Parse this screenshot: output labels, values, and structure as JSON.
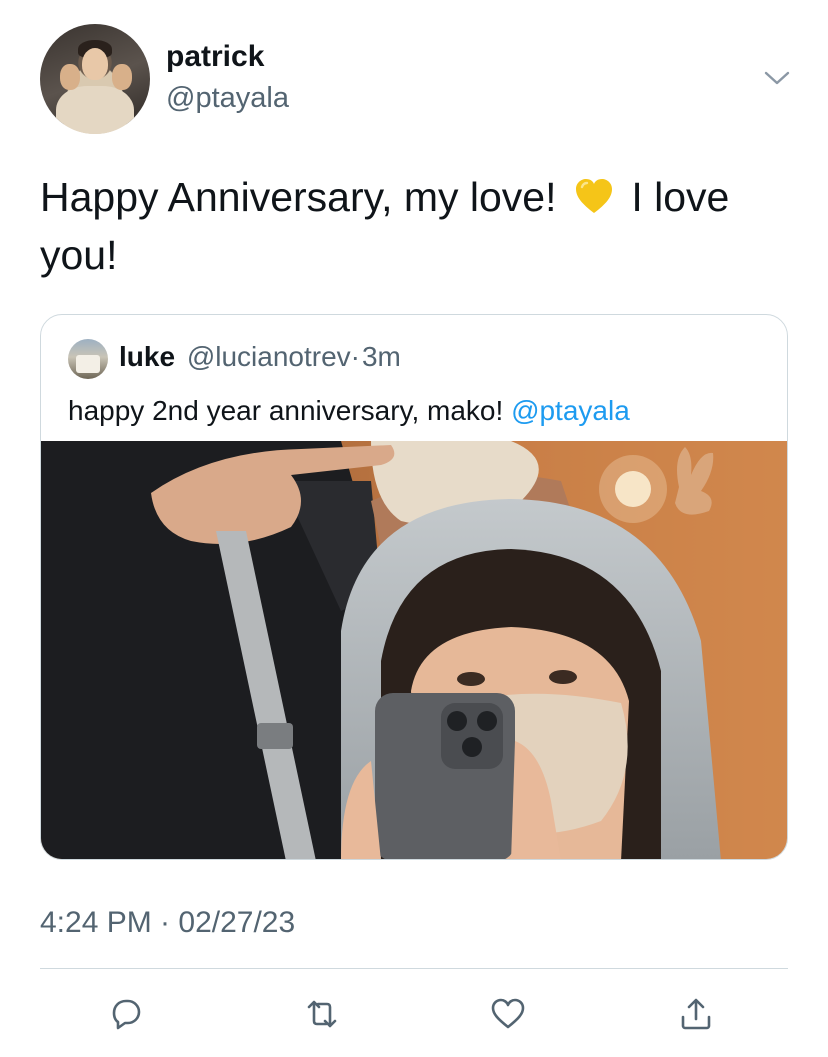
{
  "author": {
    "display_name": "patrick",
    "handle": "@ptayala"
  },
  "tweet": {
    "text_before_emoji": "Happy Anniversary, my love!",
    "emoji": "yellow-heart",
    "text_after_emoji": "I love you!"
  },
  "quoted_tweet": {
    "display_name": "luke",
    "handle": "@lucianotrev",
    "separator": "·",
    "time": "3m",
    "text": "happy 2nd year anniversary, mako!",
    "mention": "@ptayala",
    "photo": "two people taking a mirror selfie"
  },
  "timestamp": "4:24 PM · 02/27/23",
  "actions": [
    "reply-icon",
    "retweet-icon",
    "like-icon",
    "share-icon"
  ],
  "colors": {
    "text": "#0f1419",
    "secondary": "#536471",
    "link": "#1d9bf0",
    "border": "#cfd9de",
    "heart_emoji": "#f5c518"
  }
}
